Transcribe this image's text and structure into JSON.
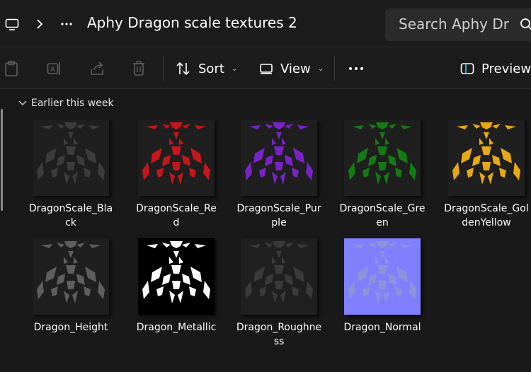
{
  "window": {
    "path_title": "Aphy Dragon scale textures 2",
    "search_placeholder": "Search Aphy Dr"
  },
  "toolbar": {
    "sort_label": "Sort",
    "view_label": "View",
    "preview_label": "Preview",
    "more_label": "•••"
  },
  "content": {
    "group_label": "Earlier this week"
  },
  "files": [
    {
      "name": "DragonScale_Bla\nck",
      "scale_color": "#3c3c3c",
      "bg": "#1f1f1f"
    },
    {
      "name": "DragonScale_Re\nd",
      "scale_color": "#c4161c",
      "bg": "#1f1f1f"
    },
    {
      "name": "DragonScale_Pur\nple",
      "scale_color": "#7a22c8",
      "bg": "#1f1f1f"
    },
    {
      "name": "DragonScale_Gre\nen",
      "scale_color": "#147a14",
      "bg": "#1f1f1f"
    },
    {
      "name": "DragonScale_Gol\ndenYellow",
      "scale_color": "#e6a817",
      "bg": "#1f1f1f"
    },
    {
      "name": "Dragon_Height",
      "scale_color": "#5e5e5e",
      "bg": "#1f1f1f"
    },
    {
      "name": "Dragon_Metallic",
      "scale_color": "#ffffff",
      "bg": "#000000"
    },
    {
      "name": "Dragon_Roughne\nss",
      "scale_color": "#3a3a3a",
      "bg": "#202020"
    },
    {
      "name": "Dragon_Normal",
      "scale_color": "#8a95d8",
      "bg": "#8080ff"
    }
  ],
  "colors": {
    "accent": "#4cc2ff",
    "background": "#191919"
  }
}
